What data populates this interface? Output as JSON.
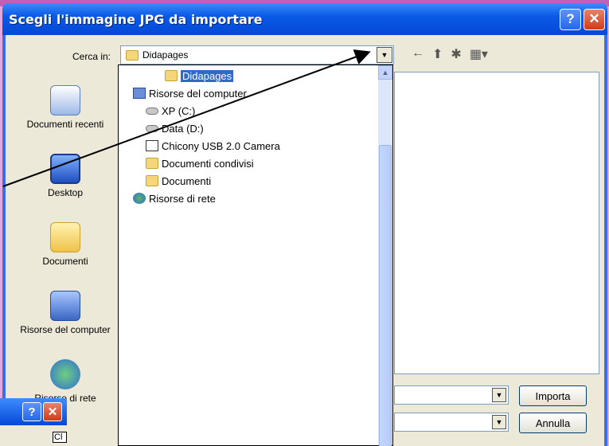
{
  "dialog": {
    "title": "Scegli l'immagine JPG da importare",
    "help_label": "?",
    "close_label": "✕"
  },
  "lookin": {
    "label": "Cerca in:",
    "value": "Didapages"
  },
  "places": [
    {
      "label": "Documenti recenti",
      "icon": "recent-documents-icon"
    },
    {
      "label": "Desktop",
      "icon": "desktop-icon"
    },
    {
      "label": "Documenti",
      "icon": "documents-icon"
    },
    {
      "label": "Risorse del computer",
      "icon": "my-computer-icon"
    },
    {
      "label": "Risorse di rete",
      "icon": "network-icon"
    }
  ],
  "dropdown": {
    "items": [
      {
        "label": "Didapages",
        "icon": "folder-icon",
        "selected": true
      },
      {
        "label": "Risorse del computer",
        "icon": "computer-icon"
      },
      {
        "label": "XP (C:)",
        "icon": "drive-icon"
      },
      {
        "label": "Data (D:)",
        "icon": "drive-icon"
      },
      {
        "label": "Chicony USB 2.0 Camera",
        "icon": "camera-icon"
      },
      {
        "label": "Documenti condivisi",
        "icon": "folder-icon"
      },
      {
        "label": "Documenti",
        "icon": "folder-icon"
      },
      {
        "label": "Risorse di rete",
        "icon": "network-icon"
      }
    ]
  },
  "buttons": {
    "import": "Importa",
    "cancel": "Annulla"
  },
  "mini_window": {
    "help_label": "?",
    "close_label": "✕",
    "partial_text": "Cl"
  },
  "colors": {
    "titlebar": "#0548d8",
    "selection": "#316ac5",
    "annotation_arrow": "#000000"
  }
}
